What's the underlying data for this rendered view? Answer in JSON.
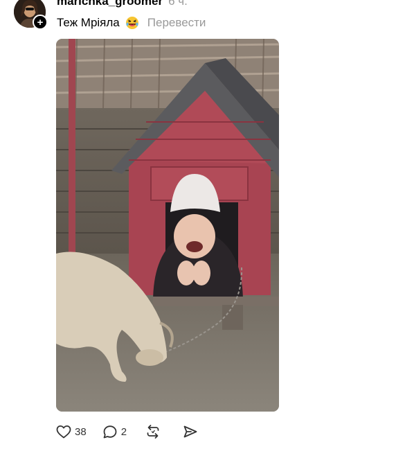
{
  "post": {
    "username": "marichka_groomer",
    "time": "6 ч.",
    "text": "Теж Мріяла",
    "emoji": "rolling-on-floor-laughing-emoji",
    "translate_label": "Перевести",
    "follow_badge": "+"
  },
  "actions": {
    "likes": "38",
    "replies": "2"
  },
  "icons": {
    "like": "heart-icon",
    "reply": "comment-bubble-icon",
    "repost": "repost-icon",
    "share": "send-icon"
  },
  "colors": {
    "text": "#000000",
    "muted": "#999999"
  }
}
